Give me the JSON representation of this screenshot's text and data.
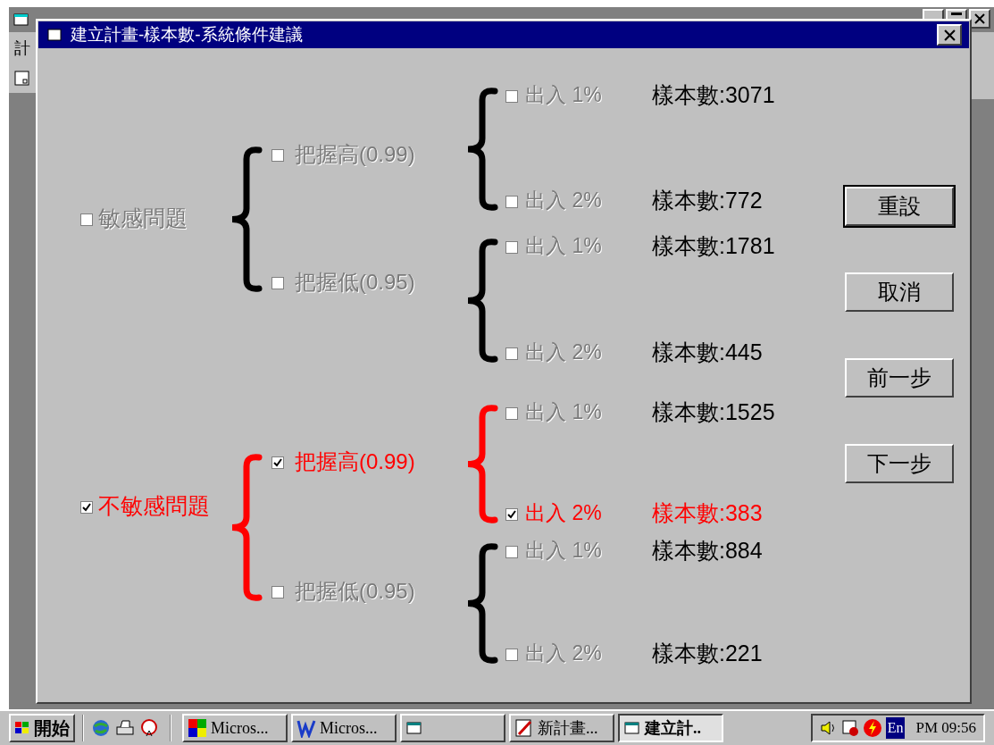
{
  "background_window": {
    "menu_item": "計"
  },
  "dialog": {
    "title": "建立計畫-樣本數-系統條件建議",
    "tree": [
      {
        "label": "敏感問題",
        "checked": false,
        "children": [
          {
            "label": "把握高(0.99)",
            "checked": false,
            "children": [
              {
                "label": "出入 1%",
                "checked": false,
                "sample": "樣本數:3071"
              },
              {
                "label": "出入 2%",
                "checked": false,
                "sample": "樣本數:772"
              }
            ]
          },
          {
            "label": "把握低(0.95)",
            "checked": false,
            "children": [
              {
                "label": "出入 1%",
                "checked": false,
                "sample": "樣本數:1781"
              },
              {
                "label": "出入 2%",
                "checked": false,
                "sample": "樣本數:445"
              }
            ]
          }
        ]
      },
      {
        "label": "不敏感問題",
        "checked": true,
        "children": [
          {
            "label": "把握高(0.99)",
            "checked": true,
            "children": [
              {
                "label": "出入 1%",
                "checked": false,
                "sample": "樣本數:1525"
              },
              {
                "label": "出入 2%",
                "checked": true,
                "sample": "樣本數:383"
              }
            ]
          },
          {
            "label": "把握低(0.95)",
            "checked": false,
            "children": [
              {
                "label": "出入 1%",
                "checked": false,
                "sample": "樣本數:884"
              },
              {
                "label": "出入 2%",
                "checked": false,
                "sample": "樣本數:221"
              }
            ]
          }
        ]
      }
    ],
    "buttons": [
      {
        "label": "重設",
        "focused": true
      },
      {
        "label": "取消",
        "focused": false
      },
      {
        "label": "前一步",
        "focused": false
      },
      {
        "label": "下一步",
        "focused": false
      }
    ]
  },
  "taskbar": {
    "start": "開始",
    "tasks": [
      {
        "label": "Micros...",
        "kind": "puzzle",
        "pressed": false
      },
      {
        "label": "Micros...",
        "kind": "word",
        "pressed": false
      },
      {
        "kind": "window",
        "pressed": false
      },
      {
        "label": "新計畫...",
        "kind": "edit",
        "pressed": false
      },
      {
        "label": "建立計..",
        "kind": "window",
        "pressed": true
      }
    ],
    "tray": {
      "language": "En",
      "clock": "PM 09:56"
    }
  }
}
